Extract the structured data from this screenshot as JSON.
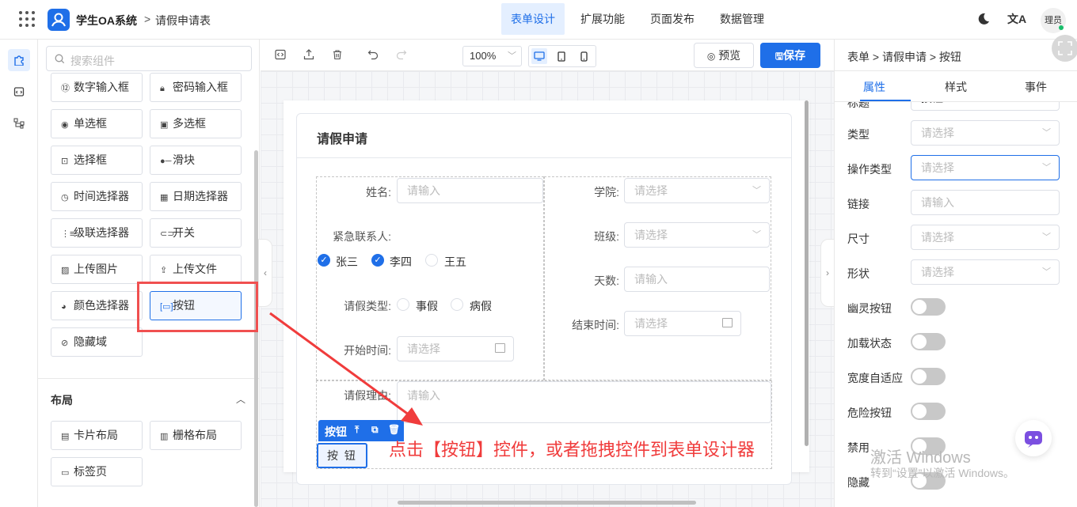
{
  "header": {
    "app_title": "学生OA系统",
    "breadcrumb_sep": ">",
    "breadcrumb": "请假申请表",
    "nav": [
      "表单设计",
      "扩展功能",
      "页面发布",
      "数据管理"
    ],
    "avatar": "理员",
    "translate_icon": "文A"
  },
  "left_panel": {
    "search_placeholder": "搜索组件",
    "components": [
      {
        "icon": "123",
        "label": "数字输入框"
      },
      {
        "icon": "lock",
        "label": "密码输入框"
      },
      {
        "icon": "radio",
        "label": "单选框"
      },
      {
        "icon": "checkbox",
        "label": "多选框"
      },
      {
        "icon": "select",
        "label": "选择框"
      },
      {
        "icon": "slider",
        "label": "滑块"
      },
      {
        "icon": "clock",
        "label": "时间选择器"
      },
      {
        "icon": "calendar",
        "label": "日期选择器"
      },
      {
        "icon": "cascader",
        "label": "级联选择器"
      },
      {
        "icon": "switch",
        "label": "开关"
      },
      {
        "icon": "image",
        "label": "上传图片"
      },
      {
        "icon": "upload",
        "label": "上传文件"
      },
      {
        "icon": "palette",
        "label": "颜色选择器"
      },
      {
        "icon": "button",
        "label": "按钮"
      },
      {
        "icon": "eye-off",
        "label": "隐藏域"
      }
    ],
    "layout_title": "布局",
    "layouts": [
      {
        "icon": "card",
        "label": "卡片布局"
      },
      {
        "icon": "grid",
        "label": "栅格布局"
      },
      {
        "icon": "tabs",
        "label": "标签页"
      }
    ]
  },
  "toolbar": {
    "zoom": "100%",
    "preview": "预览",
    "save": "保存"
  },
  "form": {
    "title": "请假申请",
    "name_label": "姓名:",
    "name_placeholder": "请输入",
    "college_label": "学院:",
    "college_placeholder": "请选择",
    "contact_label": "紧急联系人:",
    "contacts": [
      {
        "label": "张三",
        "checked": true
      },
      {
        "label": "李四",
        "checked": true
      },
      {
        "label": "王五",
        "checked": false
      }
    ],
    "class_label": "班级:",
    "class_placeholder": "请选择",
    "days_label": "天数:",
    "days_placeholder": "请输入",
    "leave_type_label": "请假类型:",
    "leave_types": [
      "事假",
      "病假"
    ],
    "end_time_label": "结束时间:",
    "end_time_placeholder": "请选择",
    "start_time_label": "开始时间:",
    "start_time_placeholder": "请选择",
    "reason_label": "请假理由:",
    "reason_placeholder": "请输入",
    "selected_tag": "按钮",
    "button_text": "按 钮"
  },
  "annotation": "点击【按钮】控件，或者拖拽控件到表单设计器",
  "right_panel": {
    "breadcrumb": "表单 > 请假申请 > 按钮",
    "tabs": [
      "属性",
      "样式",
      "事件"
    ],
    "partial_label": "标题",
    "partial_value": "按钮",
    "props": [
      {
        "label": "类型",
        "placeholder": "请选择",
        "kind": "select"
      },
      {
        "label": "操作类型",
        "placeholder": "请选择",
        "kind": "select"
      },
      {
        "label": "链接",
        "placeholder": "请输入",
        "kind": "input"
      },
      {
        "label": "尺寸",
        "placeholder": "请选择",
        "kind": "select"
      },
      {
        "label": "形状",
        "placeholder": "请选择",
        "kind": "select"
      }
    ],
    "toggles": [
      "幽灵按钮",
      "加载状态",
      "宽度自适应",
      "危险按钮",
      "禁用",
      "隐藏"
    ]
  },
  "watermark": {
    "line1": "激活 Windows",
    "line2": "转到“设置”以激活 Windows。"
  },
  "colors": {
    "accent": "#1f6fe8",
    "annotation_red": "#f03c3c"
  }
}
